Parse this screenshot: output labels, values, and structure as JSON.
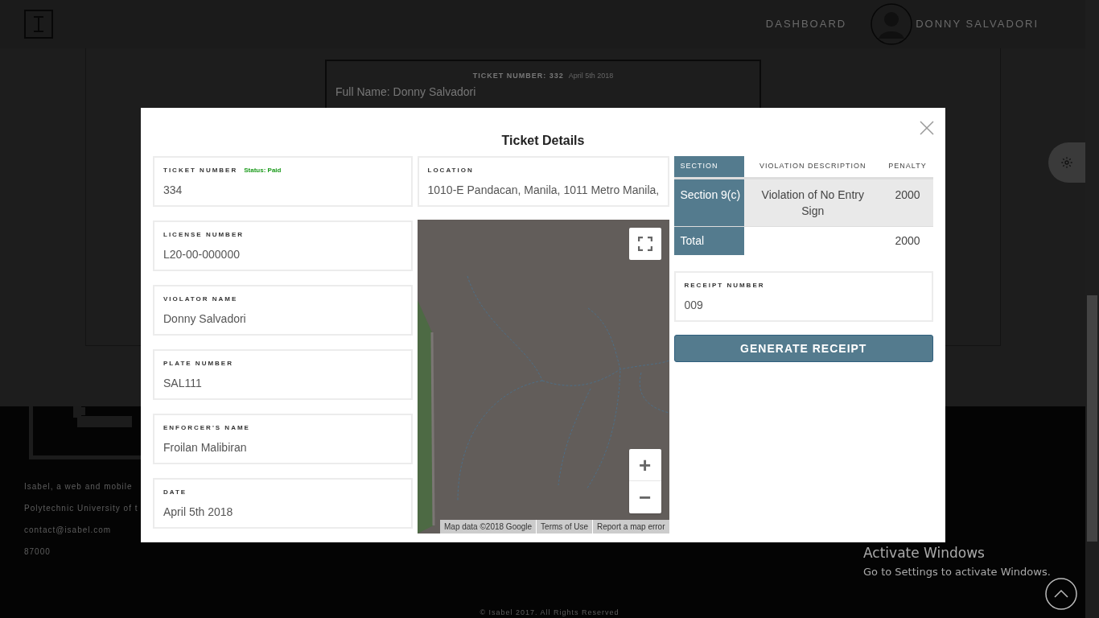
{
  "header": {
    "nav_link": "DASHBOARD",
    "user_name": "DONNY SALVADORI"
  },
  "background_card": {
    "ticket_label": "TICKET NUMBER: 332",
    "date": "April 5th 2018",
    "full_name": "Full Name: Donny Salvadori"
  },
  "footer": {
    "description": "Isabel, a web and mobile",
    "address": "Polytechnic University of t",
    "email": "contact@isabel.com",
    "phone": "87000",
    "copyright": "© Isabel 2017. All Rights Reserved"
  },
  "modal": {
    "title": "Ticket Details",
    "fields": [
      {
        "label": "TICKET NUMBER",
        "value": "334",
        "status": "Status: Paid"
      },
      {
        "label": "LICENSE NUMBER",
        "value": "L20-00-000000"
      },
      {
        "label": "VIOLATOR NAME",
        "value": "Donny Salvadori"
      },
      {
        "label": "PLATE NUMBER",
        "value": "SAL111"
      },
      {
        "label": "ENFORCER'S NAME",
        "value": "Froilan Malibiran"
      },
      {
        "label": "DATE",
        "value": "April 5th 2018"
      }
    ],
    "location": {
      "label": "LOCATION",
      "value": "1010-E Pandacan, Manila, 1011 Metro Manila,"
    },
    "map": {
      "kind": "picture",
      "zoom_in": "+",
      "zoom_out": "−",
      "attribution": [
        "Map data ©2018 Google",
        "Terms of Use",
        "Report a map error"
      ]
    },
    "table": {
      "columns": [
        "SECTION",
        "VIOLATION DESCRIPTION",
        "PENALTY"
      ],
      "rows": [
        {
          "section": "Section 9(c)",
          "description": "Violation of No Entry Sign",
          "penalty": "2000"
        }
      ],
      "total": {
        "label": "Total",
        "penalty": "2000"
      }
    },
    "receipt": {
      "label": "RECEIPT NUMBER",
      "value": "009"
    },
    "button": "GENERATE RECEIPT"
  },
  "os_notice": {
    "title": "Activate Windows",
    "text": "Go to Settings to activate Windows."
  }
}
